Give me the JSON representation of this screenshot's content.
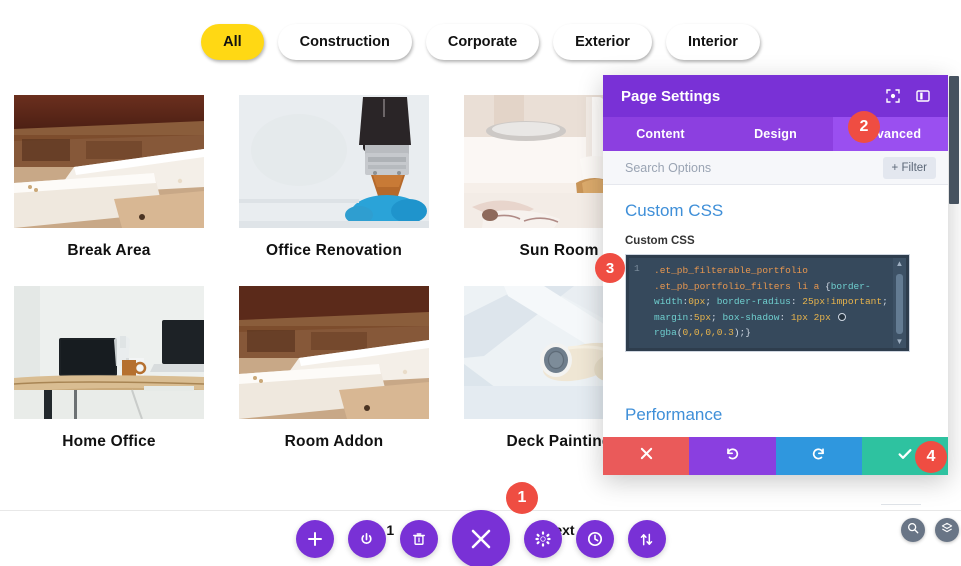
{
  "filters": {
    "items": [
      {
        "label": "All",
        "active": true
      },
      {
        "label": "Construction",
        "active": false
      },
      {
        "label": "Corporate",
        "active": false
      },
      {
        "label": "Exterior",
        "active": false
      },
      {
        "label": "Interior",
        "active": false
      }
    ],
    "active_color": "#FFD814"
  },
  "portfolio": {
    "rows": [
      [
        {
          "title": "Break Area",
          "image": "wood-planks"
        },
        {
          "title": "Office Renovation",
          "image": "paintbrush-glove"
        },
        {
          "title": "Sun Room",
          "image": "interior-candle"
        }
      ],
      [
        {
          "title": "Home Office",
          "image": "desk-laptops"
        },
        {
          "title": "Room Addon",
          "image": "wood-planks"
        },
        {
          "title": "Deck Painting",
          "image": "paint-roller"
        }
      ]
    ]
  },
  "pagination": {
    "current": "1",
    "next": "Next"
  },
  "toolbar": {
    "buttons": [
      {
        "name": "add-button",
        "icon": "plus"
      },
      {
        "name": "power-button",
        "icon": "power"
      },
      {
        "name": "trash-button",
        "icon": "trash"
      },
      {
        "name": "close-button",
        "icon": "x"
      },
      {
        "name": "settings-button",
        "icon": "gear"
      },
      {
        "name": "history-button",
        "icon": "clock"
      },
      {
        "name": "sort-button",
        "icon": "arrows-updown"
      }
    ],
    "accent_color": "#7931d6"
  },
  "modal": {
    "title": "Page Settings",
    "header_icons": [
      {
        "name": "focus-icon",
        "label": "focus"
      },
      {
        "name": "layout-icon",
        "label": "layout"
      }
    ],
    "tabs": [
      {
        "label": "Content",
        "active": false
      },
      {
        "label": "Design",
        "active": false
      },
      {
        "label": "Advanced",
        "active": true
      }
    ],
    "search": {
      "value": "",
      "placeholder": "Search Options"
    },
    "filter_button": "+ Filter",
    "section_title": "Custom CSS",
    "field_label": "Custom CSS",
    "code": {
      "line_number": "1",
      "segments": [
        {
          "text": ".et_pb_filterable_portfolio .et_pb_portfolio_filters li a ",
          "type": "selector"
        },
        {
          "text": "{",
          "type": "punc"
        },
        {
          "text": "border-width",
          "type": "property"
        },
        {
          "text": ":",
          "type": "punc"
        },
        {
          "text": "0px",
          "type": "value"
        },
        {
          "text": "; ",
          "type": "punc"
        },
        {
          "text": "border-radius",
          "type": "property"
        },
        {
          "text": ": ",
          "type": "punc"
        },
        {
          "text": "25px!important",
          "type": "value"
        },
        {
          "text": "; ",
          "type": "punc"
        },
        {
          "text": "margin",
          "type": "property"
        },
        {
          "text": ":",
          "type": "punc"
        },
        {
          "text": "5px",
          "type": "value"
        },
        {
          "text": "; ",
          "type": "punc"
        },
        {
          "text": "box-shadow",
          "type": "property"
        },
        {
          "text": ": ",
          "type": "punc"
        },
        {
          "text": "1px 2px ",
          "type": "value"
        },
        {
          "text": "SWATCH",
          "type": "swatch"
        },
        {
          "text": "rgba",
          "type": "function"
        },
        {
          "text": "(",
          "type": "punc"
        },
        {
          "text": "0,0,0,0.3",
          "type": "value"
        },
        {
          "text": ");}",
          "type": "punc"
        }
      ],
      "plain": ".et_pb_filterable_portfolio .et_pb_portfolio_filters li a {border-width:0px; border-radius: 25px!important; margin:5px; box-shadow: 1px 2px rgba(0,0,0,0.3);}"
    },
    "performance_title": "Performance",
    "footer_buttons": [
      {
        "name": "cancel-button",
        "icon": "x",
        "color": "#ea5a5a"
      },
      {
        "name": "undo-button",
        "icon": "undo",
        "color": "#8a3fe0"
      },
      {
        "name": "redo-button",
        "icon": "redo",
        "color": "#2f97de"
      },
      {
        "name": "save-button",
        "icon": "check",
        "color": "#2ec2a0"
      }
    ]
  },
  "badges": {
    "step1": "1",
    "step2": "2",
    "step3": "3",
    "step4": "4",
    "color": "#ef4d42"
  },
  "corner": {
    "buttons": [
      {
        "name": "zoom-icon",
        "label": "zoom"
      },
      {
        "name": "layers-icon",
        "label": "layers"
      }
    ]
  }
}
